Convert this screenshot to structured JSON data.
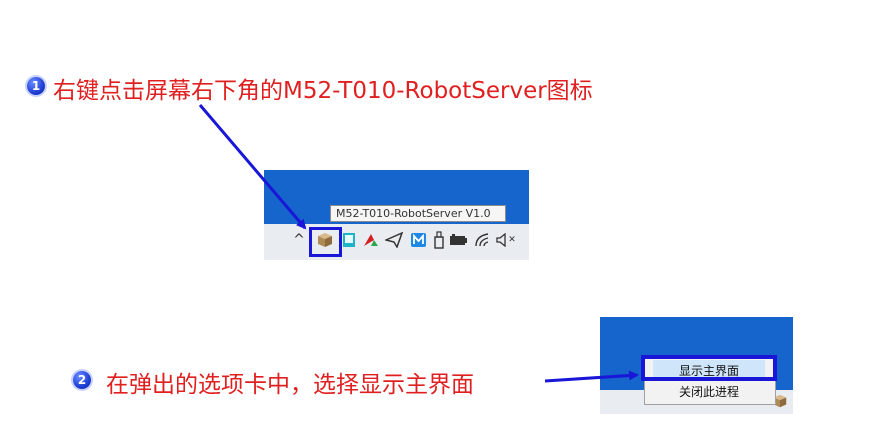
{
  "step1": {
    "number": "1",
    "text": "右键点击屏幕右下角的M52-T010-RobotServer图标"
  },
  "step2": {
    "number": "2",
    "text": "在弹出的选项卡中，选择显示主界面"
  },
  "screenshot1": {
    "tooltip": "M52-T010-RobotServer V1.0",
    "tray_icons": [
      "chevron-up-icon",
      "robotserver-box-icon",
      "teal-app-icon",
      "red-green-logo-icon",
      "send-plane-icon",
      "mail-m-icon",
      "usb-drive-icon",
      "battery-icon",
      "wifi-icon",
      "speaker-muted-icon"
    ],
    "chevron_glyph": "^",
    "muted_glyph": "✕"
  },
  "screenshot2": {
    "menu": [
      {
        "label": "显示主界面",
        "selected": true
      },
      {
        "label": "关闭此进程",
        "selected": false
      }
    ],
    "taskbar_glyph": "^"
  },
  "colors": {
    "annotation_text": "#e02020",
    "arrow": "#1a16d8",
    "desktop_blue": "#1565cc",
    "taskbar": "#e9edf2"
  }
}
